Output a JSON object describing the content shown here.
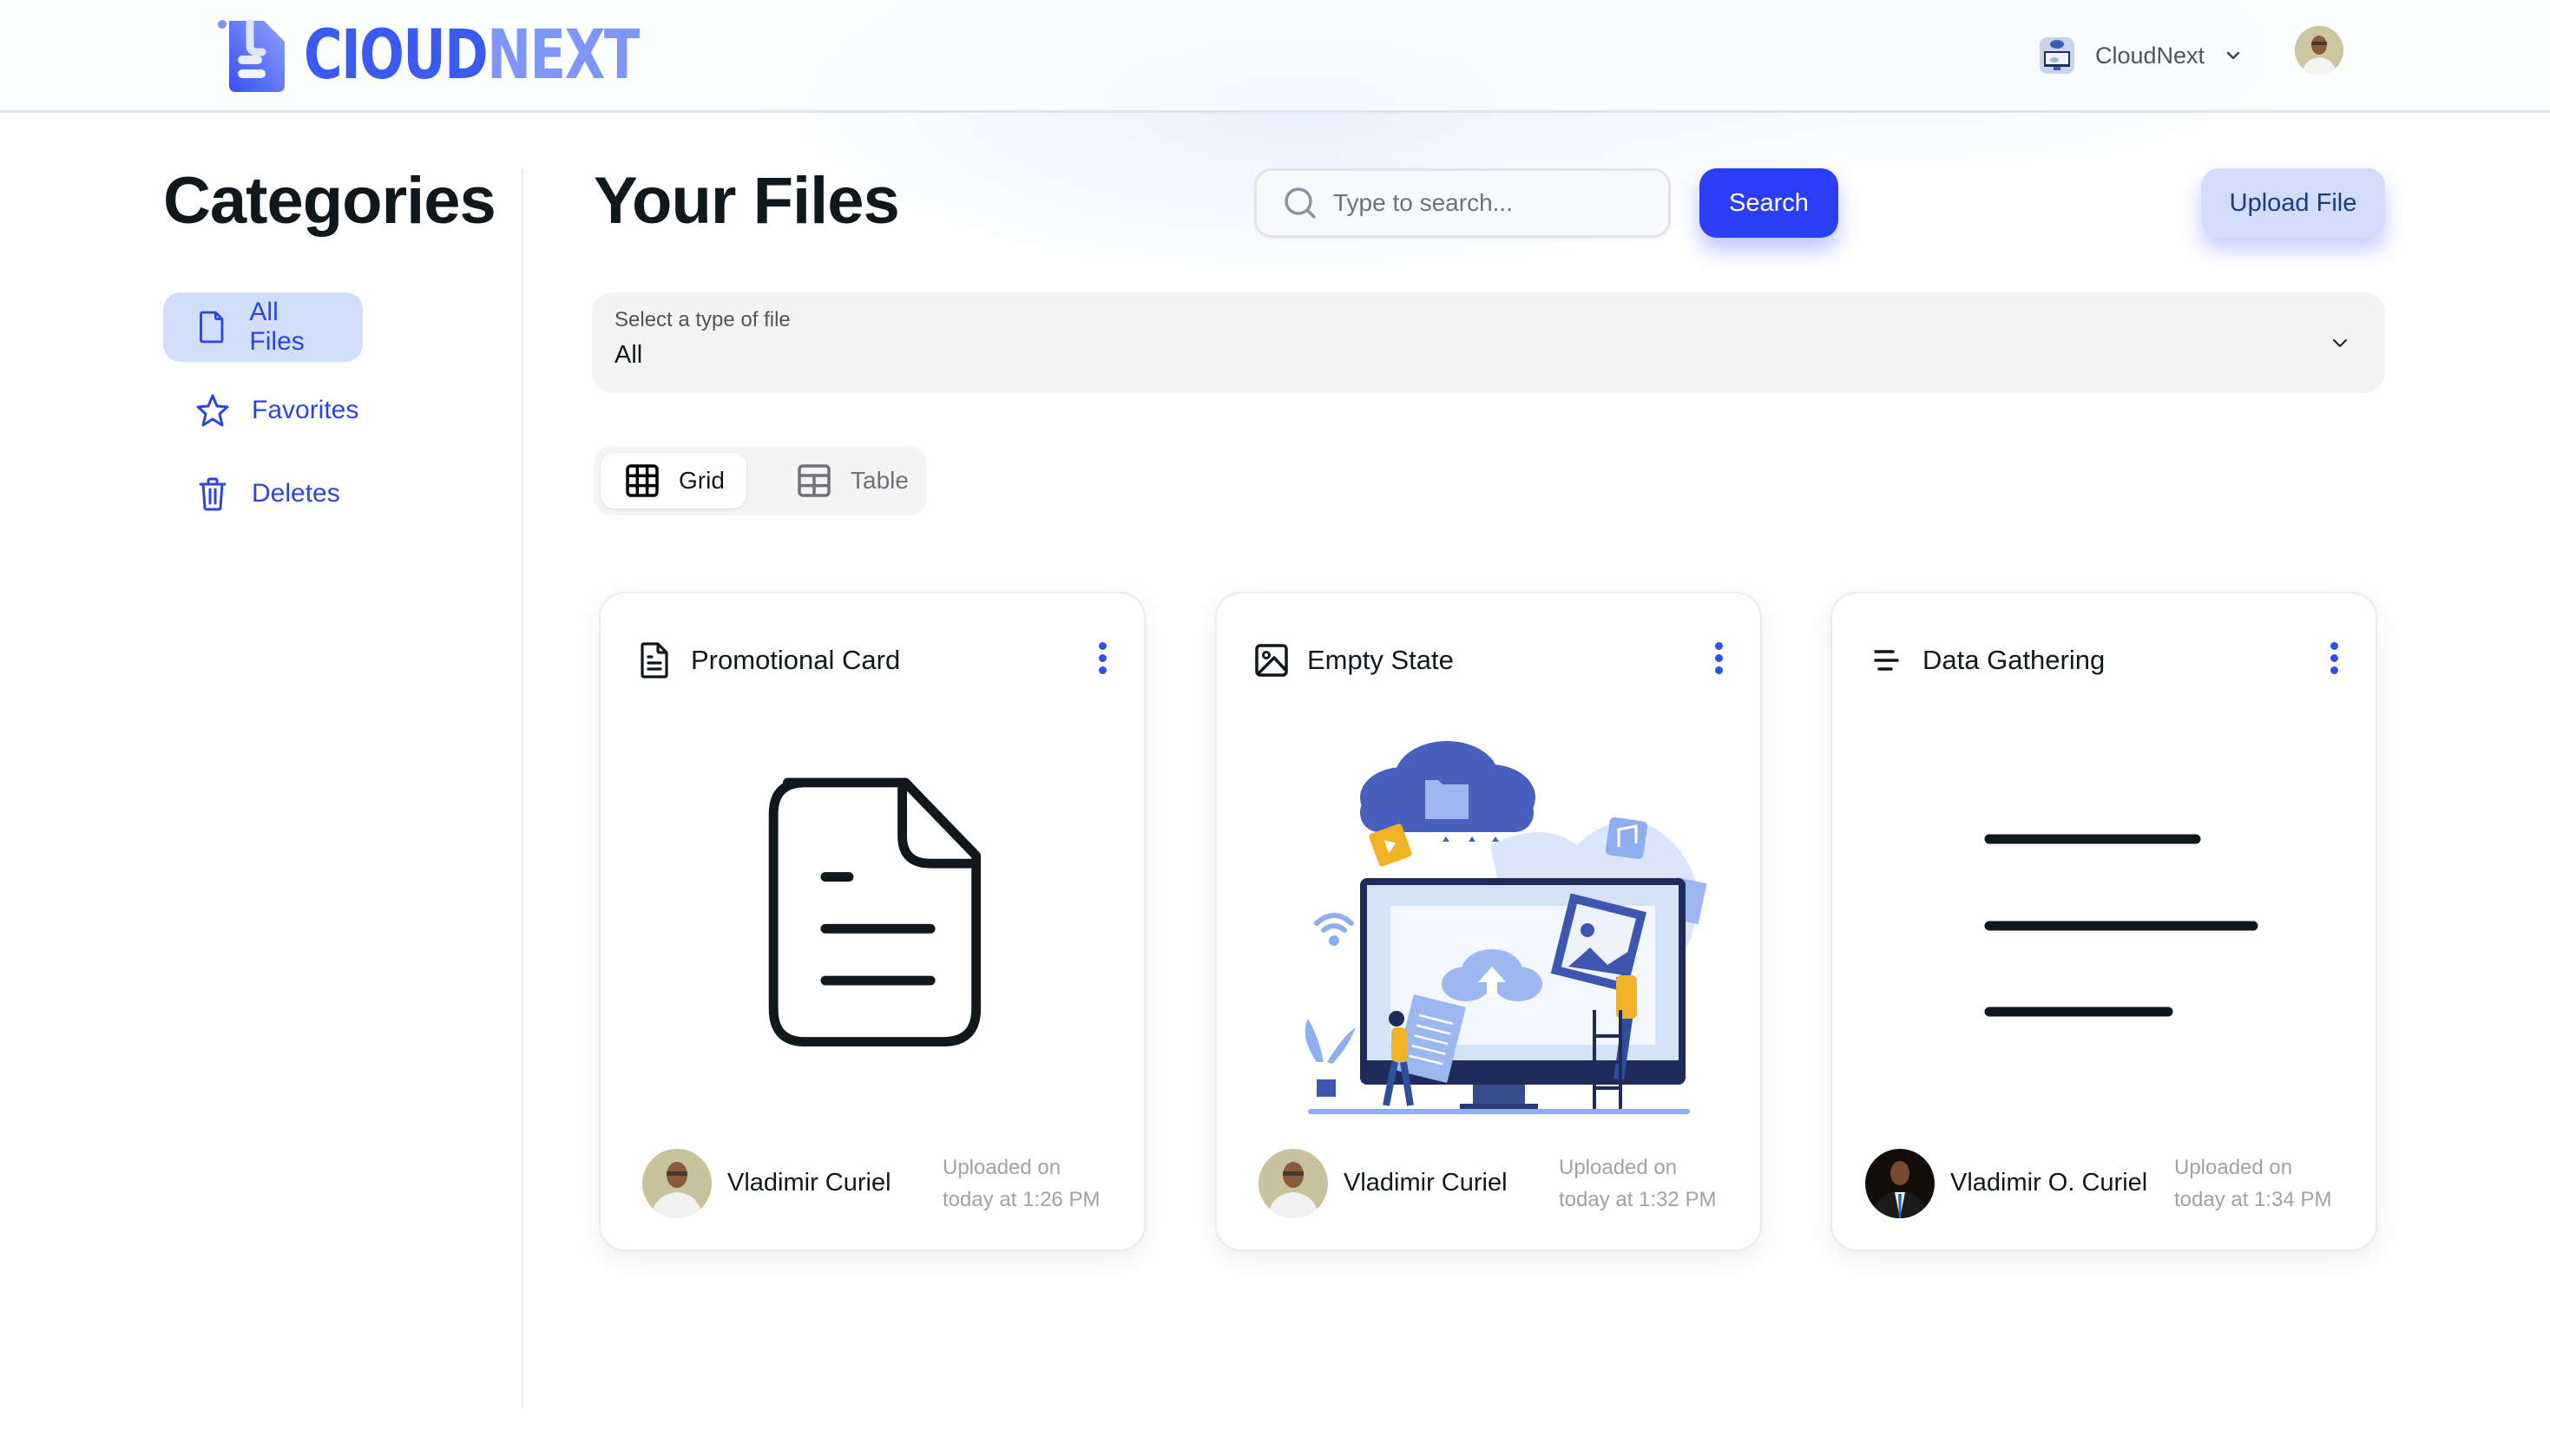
{
  "header": {
    "logo_text_part1": "CIOUD",
    "logo_text_part2": "NEXT",
    "org_name": "CloudNext",
    "org_icon": "cloud-illustration-icon",
    "user_avatar": "user-avatar-photo"
  },
  "sidebar": {
    "title": "Categories",
    "items": [
      {
        "label": "All Files",
        "icon": "file-icon",
        "active": true
      },
      {
        "label": "Favorites",
        "icon": "star-icon",
        "active": false
      },
      {
        "label": "Deletes",
        "icon": "trash-icon",
        "active": false
      }
    ]
  },
  "main": {
    "title": "Your Files",
    "search": {
      "placeholder": "Type to search...",
      "value": "",
      "button_label": "Search"
    },
    "upload_label": "Upload File",
    "file_type_select": {
      "label": "Select a type of file",
      "value": "All"
    },
    "view_toggle": [
      {
        "label": "Grid",
        "icon": "grid-icon",
        "active": true
      },
      {
        "label": "Table",
        "icon": "table-icon",
        "active": false
      }
    ],
    "files": [
      {
        "title": "Promotional Card",
        "type_icon": "document-icon",
        "preview": "document-preview",
        "uploader": "Vladimir Curiel",
        "uploaded_label": "Uploaded on",
        "uploaded_time": "today at 1:26 PM"
      },
      {
        "title": "Empty State",
        "type_icon": "image-icon",
        "preview": "cloud-upload-illustration",
        "uploader": "Vladimir Curiel",
        "uploaded_label": "Uploaded on",
        "uploaded_time": "today at 1:32 PM"
      },
      {
        "title": "Data Gathering",
        "type_icon": "text-lines-icon",
        "preview": "text-lines-preview",
        "uploader": "Vladimir O. Curiel",
        "uploaded_label": "Uploaded on",
        "uploaded_time": "today at 1:34 PM"
      }
    ]
  },
  "colors": {
    "accent": "#2a3ff5",
    "sidebar_active_bg": "#d2def7",
    "sidebar_text": "#2d45e0",
    "upload_bg": "#d4dcfc",
    "kebab": "#2f4ff0"
  }
}
